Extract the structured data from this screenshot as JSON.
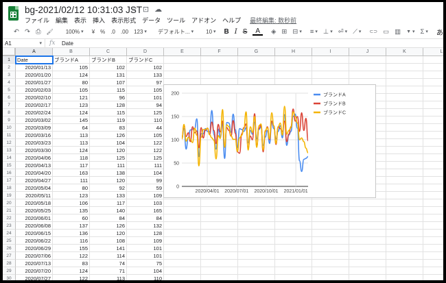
{
  "app": {
    "title": "bg-2021/02/12 10:31:03 JST",
    "star_icon": "☆",
    "move_icon": "⊡",
    "cloud_icon": "☁"
  },
  "menu": [
    "ファイル",
    "編集",
    "表示",
    "挿入",
    "表示形式",
    "データ",
    "ツール",
    "アドオン",
    "ヘルプ"
  ],
  "last_edit": "最終編集: 数秒前",
  "toolbar": {
    "undo": "↶",
    "redo": "↷",
    "print": "⎙",
    "paint_format": "🖌",
    "zoom": "100%",
    "currency": "¥",
    "percent": "%",
    "decimal_decrease": ".0",
    "decimal_increase": ".00",
    "more_formats": "123",
    "font": "デフォルト...",
    "font_size": "10",
    "bold": "B",
    "italic": "I",
    "strike": "S",
    "text_color": "A",
    "fill": "◈",
    "borders": "⊞",
    "merge": "⊟",
    "halign": "≡",
    "valign": "⊥",
    "wrap": "⏎",
    "rotate": "⟋",
    "link": "⊂⊃",
    "comment": "▭",
    "chart": "▥",
    "filter": "▼",
    "functions": "Σ",
    "input_tools": "あ"
  },
  "formula_bar": {
    "cell_ref": "A1",
    "fx": "fx",
    "value": "Date"
  },
  "columns": [
    "A",
    "B",
    "C",
    "D",
    "E",
    "F",
    "G",
    "H",
    "I",
    "J",
    "K",
    "L"
  ],
  "row_numbers": [
    "1",
    "2",
    "3",
    "4",
    "5",
    "6",
    "7",
    "8",
    "9",
    "10",
    "11",
    "12",
    "13",
    "14",
    "15",
    "16",
    "17",
    "18",
    "19",
    "20",
    "21",
    "22",
    "23",
    "24",
    "25",
    "26",
    "27",
    "28",
    "29",
    "30"
  ],
  "headers": [
    "Date",
    "ブランドA",
    "ブランドB",
    "ブランドC"
  ],
  "rows": [
    [
      "2020/01/13",
      "105",
      "102",
      "102"
    ],
    [
      "2020/01/20",
      "124",
      "131",
      "133"
    ],
    [
      "2020/01/27",
      "80",
      "107",
      "97"
    ],
    [
      "2020/02/03",
      "105",
      "115",
      "105"
    ],
    [
      "2020/02/10",
      "121",
      "96",
      "101"
    ],
    [
      "2020/02/17",
      "123",
      "128",
      "94"
    ],
    [
      "2020/02/24",
      "124",
      "115",
      "125"
    ],
    [
      "2020/03/02",
      "145",
      "119",
      "110"
    ],
    [
      "2020/03/09",
      "64",
      "83",
      "44"
    ],
    [
      "2020/03/16",
      "113",
      "126",
      "105"
    ],
    [
      "2020/03/23",
      "113",
      "104",
      "122"
    ],
    [
      "2020/03/30",
      "124",
      "120",
      "122"
    ],
    [
      "2020/04/06",
      "118",
      "125",
      "125"
    ],
    [
      "2020/04/13",
      "117",
      "111",
      "111"
    ],
    [
      "2020/04/20",
      "163",
      "138",
      "104"
    ],
    [
      "2020/04/27",
      "111",
      "120",
      "99"
    ],
    [
      "2020/05/04",
      "80",
      "92",
      "59"
    ],
    [
      "2020/05/11",
      "123",
      "133",
      "109"
    ],
    [
      "2020/05/18",
      "106",
      "117",
      "103"
    ],
    [
      "2020/05/25",
      "135",
      "140",
      "165"
    ],
    [
      "2020/06/01",
      "60",
      "84",
      "84"
    ],
    [
      "2020/06/08",
      "137",
      "126",
      "132"
    ],
    [
      "2020/06/15",
      "136",
      "120",
      "128"
    ],
    [
      "2020/06/22",
      "116",
      "108",
      "109"
    ],
    [
      "2020/06/29",
      "155",
      "141",
      "101"
    ],
    [
      "2020/07/06",
      "122",
      "114",
      "101"
    ],
    [
      "2020/07/13",
      "83",
      "74",
      "75"
    ],
    [
      "2020/07/20",
      "124",
      "71",
      "104"
    ],
    [
      "2020/07/27",
      "122",
      "113",
      "110"
    ]
  ],
  "chart_data": {
    "type": "line",
    "x_range": [
      "2020/01/13",
      "2021/02/08"
    ],
    "ylim": [
      0,
      200
    ],
    "y_ticks": [
      "0",
      "50",
      "100",
      "150",
      "200"
    ],
    "x_ticks": [
      {
        "label": "2020/04/01",
        "date": "2020/04/01"
      },
      {
        "label": "2020/07/01",
        "date": "2020/07/01"
      },
      {
        "label": "2020/10/01",
        "date": "2020/10/01"
      },
      {
        "label": "2021/01/01",
        "date": "2021/01/01"
      }
    ],
    "legend_position": "right",
    "grid": true,
    "series": [
      {
        "name": "ブランドA",
        "color": "#4a8cf0",
        "values": [
          105,
          124,
          80,
          105,
          121,
          123,
          124,
          145,
          64,
          113,
          113,
          124,
          118,
          117,
          163,
          111,
          80,
          123,
          106,
          135,
          60,
          137,
          136,
          116,
          155,
          122,
          83,
          124,
          122,
          118,
          126,
          94,
          120,
          112,
          138,
          102,
          122,
          128,
          88,
          106,
          120,
          92,
          137,
          124,
          102,
          118,
          130,
          104,
          154,
          88,
          110,
          118,
          150,
          155,
          125,
          55,
          32,
          58,
          60,
          64
        ]
      },
      {
        "name": "ブランドB",
        "color": "#db4437",
        "values": [
          102,
          131,
          107,
          115,
          96,
          128,
          115,
          119,
          83,
          126,
          104,
          120,
          125,
          111,
          138,
          120,
          92,
          133,
          117,
          140,
          84,
          126,
          120,
          108,
          141,
          114,
          74,
          71,
          113,
          126,
          134,
          82,
          108,
          100,
          156,
          86,
          124,
          132,
          74,
          118,
          128,
          100,
          140,
          130,
          90,
          128,
          124,
          118,
          140,
          96,
          112,
          128,
          166,
          140,
          150,
          118,
          158,
          120,
          146,
          98
        ]
      },
      {
        "name": "ブランドC",
        "color": "#f4b400",
        "values": [
          102,
          133,
          97,
          105,
          101,
          94,
          125,
          110,
          44,
          105,
          122,
          122,
          125,
          111,
          104,
          99,
          59,
          109,
          103,
          165,
          84,
          132,
          128,
          109,
          101,
          101,
          75,
          104,
          110,
          124,
          160,
          78,
          128,
          116,
          150,
          84,
          130,
          134,
          78,
          120,
          126,
          102,
          158,
          130,
          92,
          128,
          136,
          110,
          172,
          112,
          120,
          126,
          160,
          150,
          136,
          100,
          104,
          96,
          82,
          72
        ]
      }
    ]
  }
}
